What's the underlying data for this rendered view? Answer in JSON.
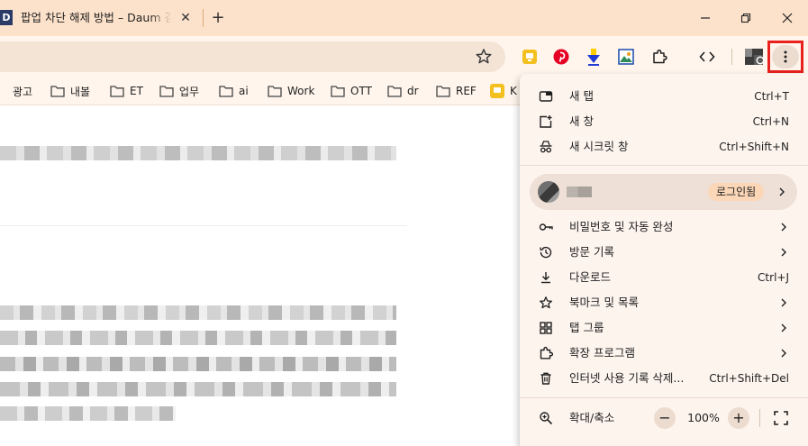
{
  "tab": {
    "favicon_text": "D",
    "title": "팝업 차단 해제 방법 – Daum 검색",
    "close": "✕",
    "new_tab": "+"
  },
  "window": {
    "minimize": "—",
    "restore": "❐",
    "close": "✕"
  },
  "bookmarks": [
    "광고",
    "내볼",
    "ET",
    "업무",
    "ai",
    "Work",
    "OTT",
    "dr",
    "REF",
    "K"
  ],
  "menu": {
    "new_tab": {
      "label": "새 탭",
      "shortcut": "Ctrl+T"
    },
    "new_window": {
      "label": "새 창",
      "shortcut": "Ctrl+N"
    },
    "incognito": {
      "label": "새 시크릿 창",
      "shortcut": "Ctrl+Shift+N"
    },
    "profile": {
      "signin": "로그인됨"
    },
    "passwords": {
      "label": "비밀번호 및 자동 완성"
    },
    "history": {
      "label": "방문 기록"
    },
    "downloads": {
      "label": "다운로드",
      "shortcut": "Ctrl+J"
    },
    "bookmarks": {
      "label": "북마크 및 목록"
    },
    "tab_groups": {
      "label": "탭 그룹"
    },
    "extensions": {
      "label": "확장 프로그램"
    },
    "clear_data": {
      "label": "인터넷 사용 기록 삭제...",
      "shortcut": "Ctrl+Shift+Del"
    },
    "zoom": {
      "label": "확대/축소",
      "minus": "−",
      "value": "100%",
      "plus": "+"
    }
  },
  "colors": {
    "tabstrip": "#fde2cb",
    "toolbar": "#fff5ec",
    "menu_bg": "#fdf4ee",
    "highlight_box": "#e8211e",
    "signin_badge": "#fbd6b7"
  }
}
